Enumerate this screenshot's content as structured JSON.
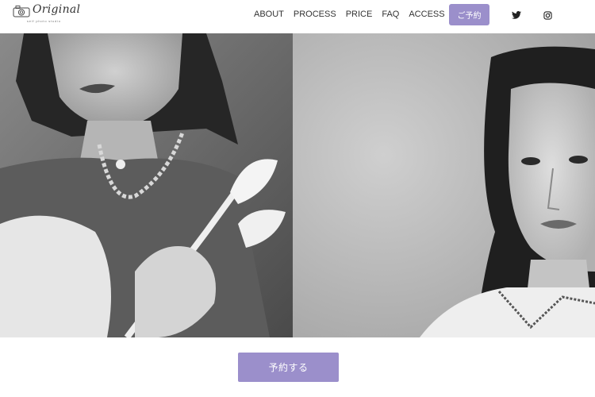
{
  "brand": {
    "name": "Original",
    "tagline": "self photo studio"
  },
  "nav": {
    "items": [
      {
        "label": "ABOUT"
      },
      {
        "label": "PROCESS"
      },
      {
        "label": "PRICE"
      },
      {
        "label": "FAQ"
      },
      {
        "label": "ACCESS"
      }
    ],
    "reserve_label": "ご予約"
  },
  "social": {
    "twitter_icon": "twitter-icon",
    "instagram_icon": "instagram-icon"
  },
  "hero": {
    "left_image": "monochrome-portrait-woman-holding-calla-lily",
    "right_image": "monochrome-portrait-woman-white-collar"
  },
  "cta": {
    "label": "予約する"
  },
  "colors": {
    "accent": "#9b8fcb",
    "text": "#333333",
    "background": "#ffffff"
  }
}
